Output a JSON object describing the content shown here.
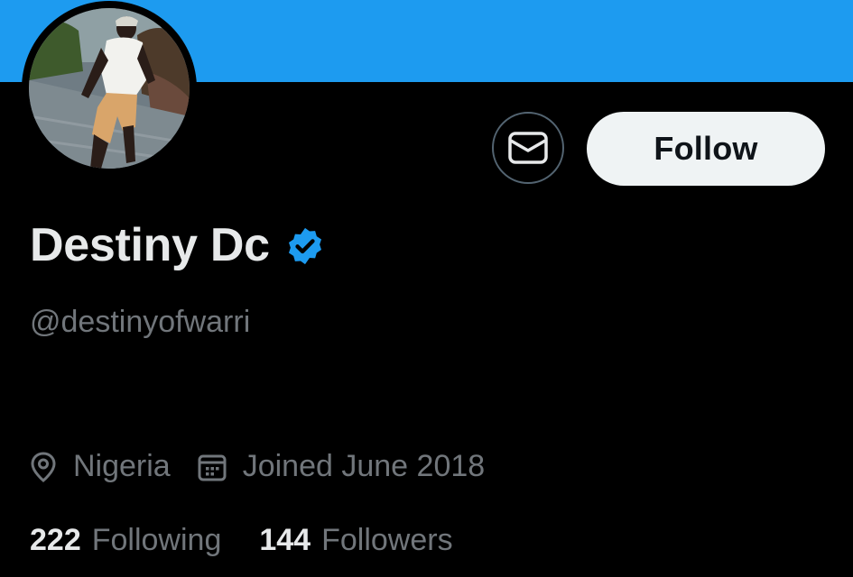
{
  "profile": {
    "display_name": "Destiny Dc",
    "handle": "@destinyofwarri",
    "verified": true,
    "location": "Nigeria",
    "joined": "Joined June 2018"
  },
  "actions": {
    "follow_label": "Follow"
  },
  "stats": {
    "following_count": "222",
    "following_label": "Following",
    "followers_count": "144",
    "followers_label": "Followers"
  },
  "colors": {
    "banner": "#1d9bf0",
    "verified_badge": "#1d9bf0",
    "background": "#000000",
    "primary_text": "#e7e9ea",
    "secondary_text": "#71767b"
  },
  "icons": {
    "message": "envelope-icon",
    "location": "location-pin-icon",
    "joined": "calendar-icon",
    "verified": "verified-badge-icon"
  }
}
